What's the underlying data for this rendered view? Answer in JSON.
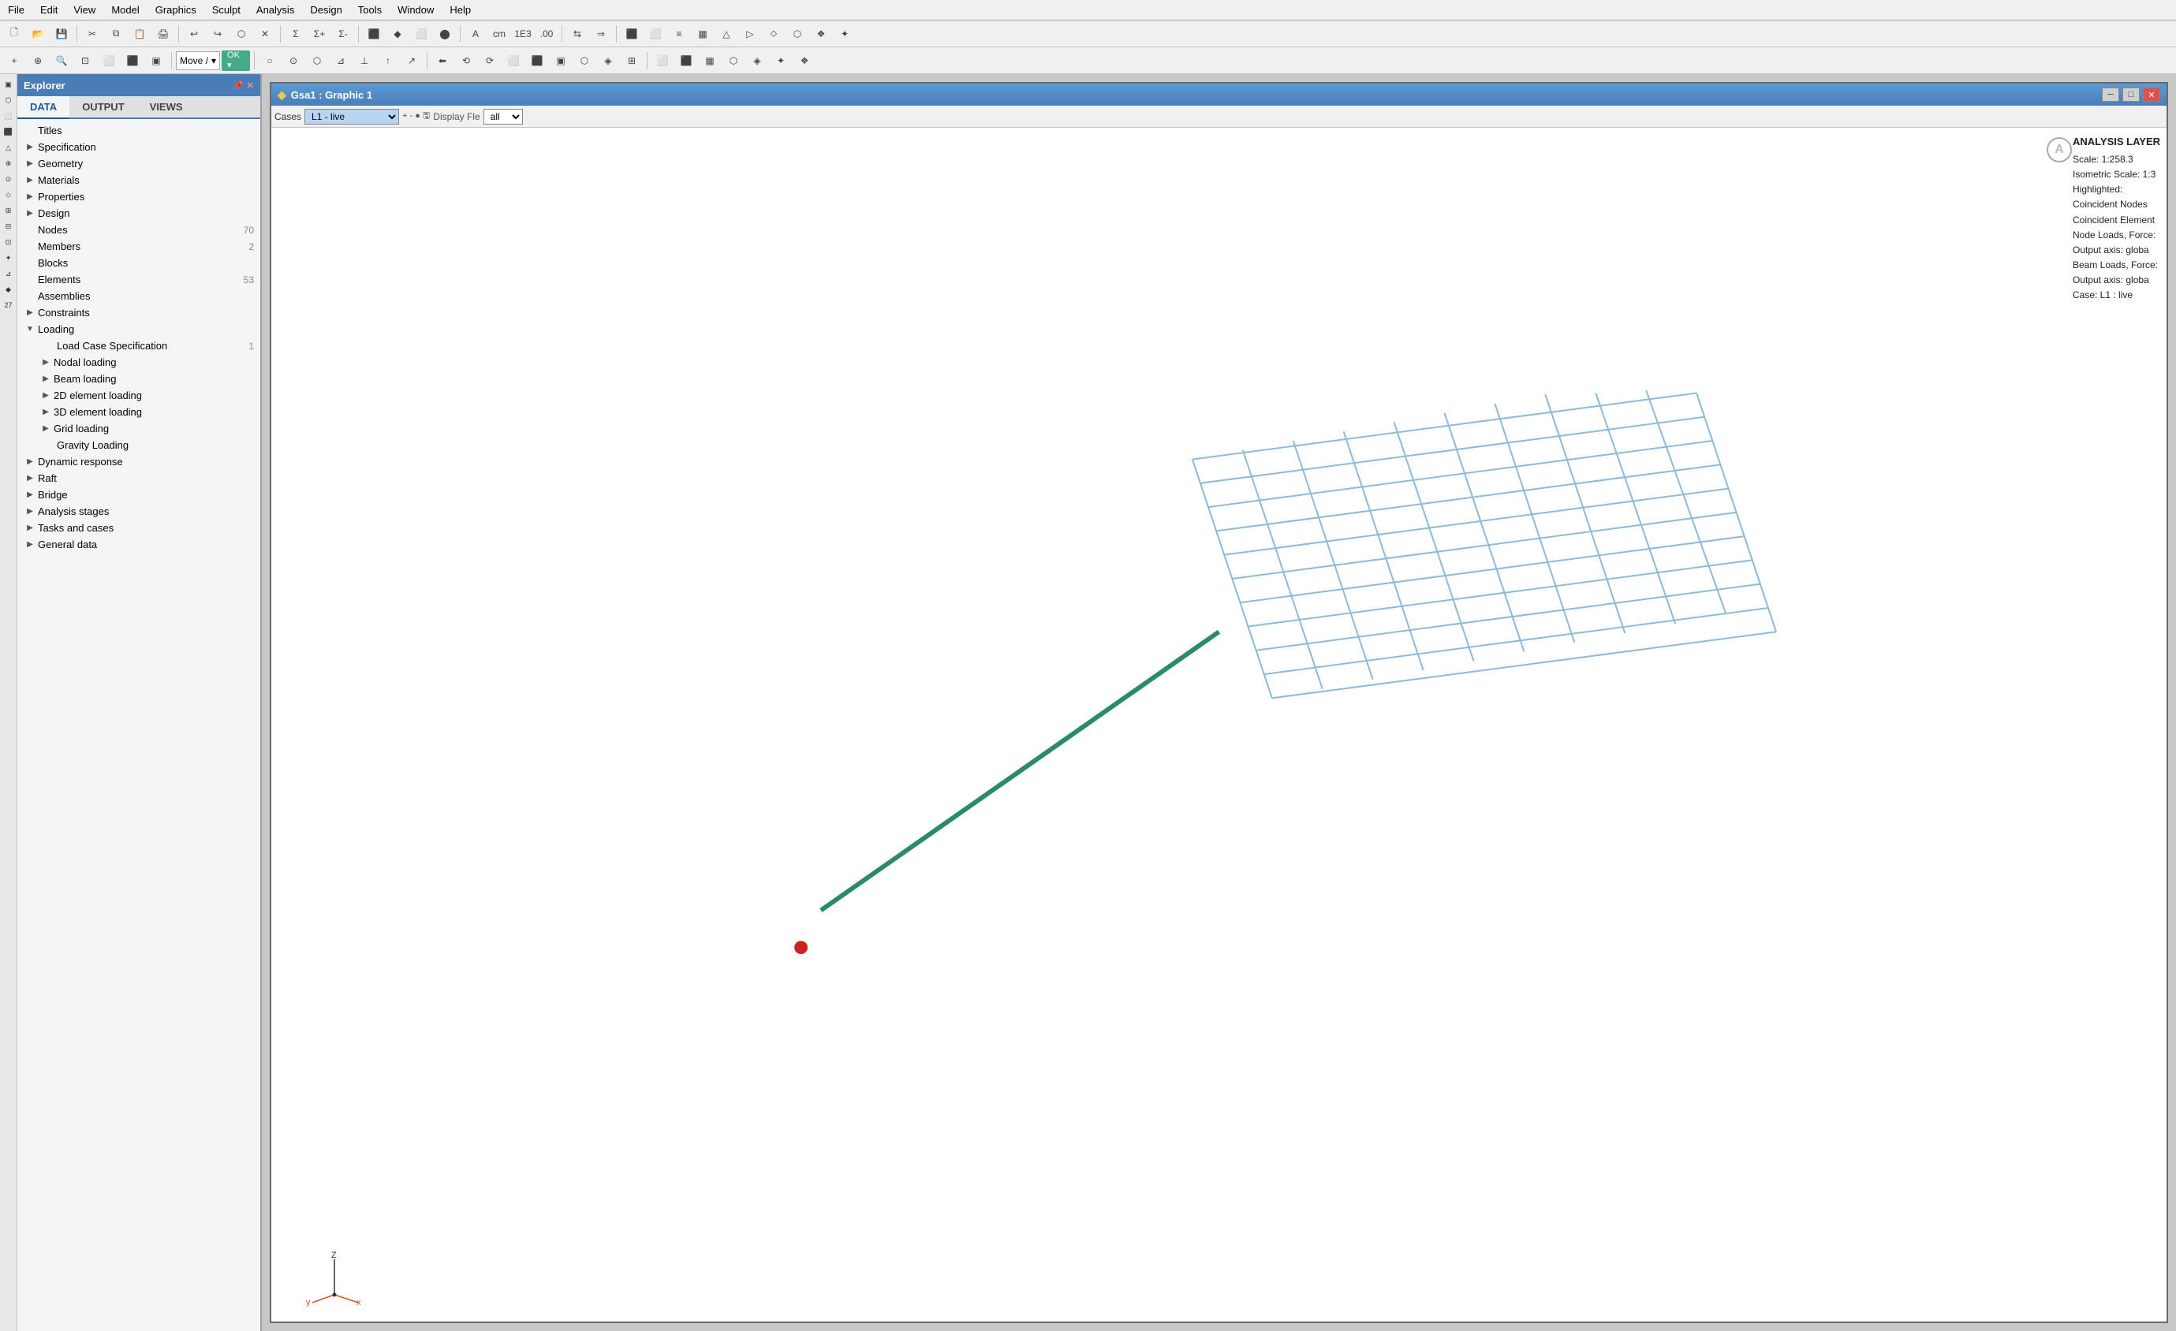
{
  "app": {
    "menu_items": [
      "File",
      "Edit",
      "View",
      "Model",
      "Graphics",
      "Sculpt",
      "Analysis",
      "Design",
      "Tools",
      "Window",
      "Help"
    ]
  },
  "explorer": {
    "title": "Explorer",
    "tabs": [
      "DATA",
      "OUTPUT",
      "VIEWS"
    ],
    "active_tab": "DATA",
    "tree": [
      {
        "id": "titles",
        "label": "Titles",
        "indent": 0,
        "arrow": false
      },
      {
        "id": "specification",
        "label": "Specification",
        "indent": 0,
        "arrow": true,
        "expanded": false
      },
      {
        "id": "geometry",
        "label": "Geometry",
        "indent": 0,
        "arrow": true,
        "expanded": false
      },
      {
        "id": "materials",
        "label": "Materials",
        "indent": 0,
        "arrow": true,
        "expanded": false
      },
      {
        "id": "properties",
        "label": "Properties",
        "indent": 0,
        "arrow": true,
        "expanded": false
      },
      {
        "id": "design",
        "label": "Design",
        "indent": 0,
        "arrow": true,
        "expanded": false
      },
      {
        "id": "nodes",
        "label": "Nodes",
        "indent": 0,
        "arrow": false,
        "count": "70"
      },
      {
        "id": "members",
        "label": "Members",
        "indent": 0,
        "arrow": false,
        "count": "2"
      },
      {
        "id": "blocks",
        "label": "Blocks",
        "indent": 0,
        "arrow": false
      },
      {
        "id": "elements",
        "label": "Elements",
        "indent": 0,
        "arrow": false,
        "count": "53"
      },
      {
        "id": "assemblies",
        "label": "Assemblies",
        "indent": 0,
        "arrow": false
      },
      {
        "id": "constraints",
        "label": "Constraints",
        "indent": 0,
        "arrow": true,
        "expanded": false
      },
      {
        "id": "loading",
        "label": "Loading",
        "indent": 0,
        "arrow": true,
        "expanded": true
      },
      {
        "id": "load-case-spec",
        "label": "Load Case Specification",
        "indent": 1,
        "arrow": false,
        "count": "1"
      },
      {
        "id": "nodal-loading",
        "label": "Nodal loading",
        "indent": 1,
        "arrow": true,
        "expanded": false
      },
      {
        "id": "beam-loading",
        "label": "Beam loading",
        "indent": 1,
        "arrow": true,
        "expanded": false
      },
      {
        "id": "2d-element-loading",
        "label": "2D element loading",
        "indent": 1,
        "arrow": true,
        "expanded": false
      },
      {
        "id": "3d-element-loading",
        "label": "3D element loading",
        "indent": 1,
        "arrow": true,
        "expanded": false
      },
      {
        "id": "grid-loading",
        "label": "Grid loading",
        "indent": 1,
        "arrow": true,
        "expanded": false
      },
      {
        "id": "gravity-loading",
        "label": "Gravity Loading",
        "indent": 1,
        "arrow": false
      },
      {
        "id": "dynamic-response",
        "label": "Dynamic response",
        "indent": 0,
        "arrow": true,
        "expanded": false
      },
      {
        "id": "raft",
        "label": "Raft",
        "indent": 0,
        "arrow": true,
        "expanded": false
      },
      {
        "id": "bridge",
        "label": "Bridge",
        "indent": 0,
        "arrow": true,
        "expanded": false
      },
      {
        "id": "analysis-stages",
        "label": "Analysis stages",
        "indent": 0,
        "arrow": true,
        "expanded": false
      },
      {
        "id": "tasks-and-cases",
        "label": "Tasks and cases",
        "indent": 0,
        "arrow": true,
        "expanded": false
      },
      {
        "id": "general-data",
        "label": "General data",
        "indent": 0,
        "arrow": true,
        "expanded": false
      }
    ]
  },
  "graphic": {
    "title": "Gsa1 : Graphic 1",
    "cases_label": "Cases",
    "cases_value": "L1 - live",
    "display_filter_label": "Display Fle",
    "display_filter_value": "all",
    "analysis_layer": {
      "title": "ANALYSIS LAYER",
      "scale": "Scale: 1:258.3",
      "isometric_scale": "Isometric Scale: 1:3",
      "highlighted_label": "Highlighted:",
      "coincident_nodes": "Coincident Nodes",
      "coincident_element": "Coincident Element",
      "node_loads": "Node Loads, Force:",
      "node_loads_output": "Output axis: globa",
      "beam_loads": "Beam Loads, Force:",
      "beam_loads_output": "Output axis: globa",
      "case": "Case: L1 : live"
    }
  },
  "icons": {
    "arrow_right": "▶",
    "arrow_down": "▼",
    "minus": "─",
    "close": "✕",
    "minimize": "─",
    "maximize": "□",
    "pin": "📌",
    "x_close": "✕"
  }
}
